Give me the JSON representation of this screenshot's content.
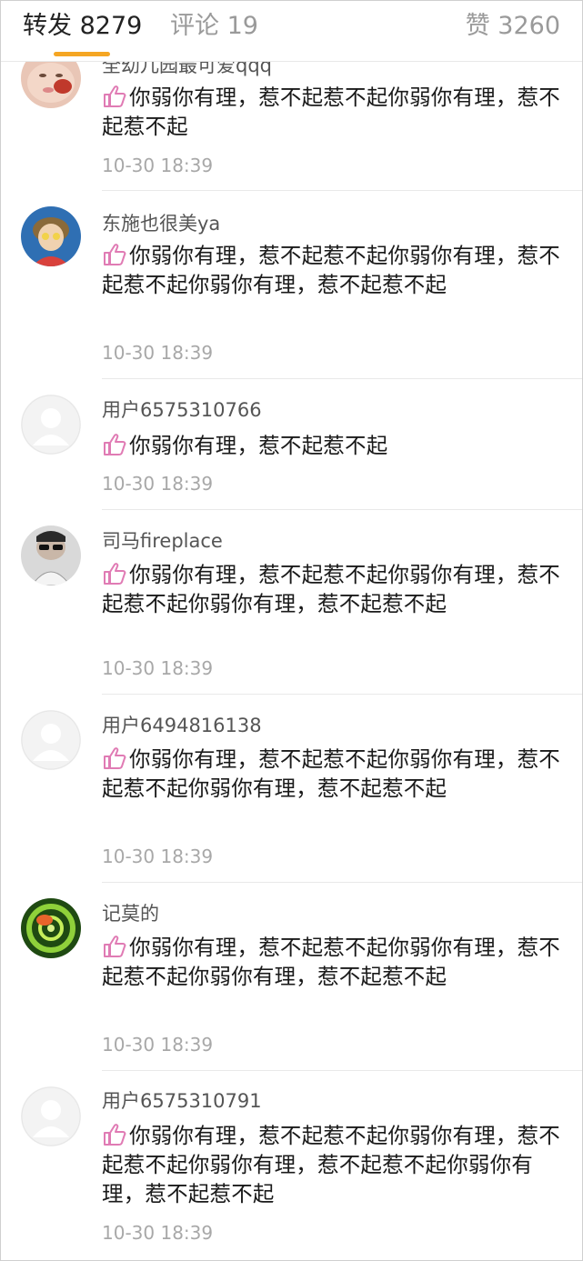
{
  "tabs": {
    "repost_label": "转发",
    "repost_count": "8279",
    "comments_label": "评论 19",
    "likes_label": "赞 3260",
    "accent_color": "#f5a623"
  },
  "items": [
    {
      "name": "全幼儿园最可爱qqq",
      "avatar_icon": "baby-photo-avatar",
      "text": "你弱你有理，惹不起惹不起你弱你有理，惹不起惹不起",
      "time": "10-30 18:39"
    },
    {
      "name": "东施也很美ya",
      "avatar_icon": "cartoon-girl-avatar",
      "text": "你弱你有理，惹不起惹不起你弱你有理，惹不起惹不起你弱你有理，惹不起惹不起",
      "time": "10-30 18:39"
    },
    {
      "name": "用户6575310766",
      "avatar_icon": "default-user-avatar",
      "text": "你弱你有理，惹不起惹不起",
      "time": "10-30 18:39"
    },
    {
      "name": "司马fireplace",
      "avatar_icon": "sunglasses-man-avatar",
      "text": "你弱你有理，惹不起惹不起你弱你有理，惹不起惹不起你弱你有理，惹不起惹不起",
      "time": "10-30 18:39"
    },
    {
      "name": "用户6494816138",
      "avatar_icon": "default-user-avatar",
      "text": "你弱你有理，惹不起惹不起你弱你有理，惹不起惹不起你弱你有理，惹不起惹不起",
      "time": "10-30 18:39"
    },
    {
      "name": "记莫的",
      "avatar_icon": "green-swirl-avatar",
      "text": "你弱你有理，惹不起惹不起你弱你有理，惹不起惹不起你弱你有理，惹不起惹不起",
      "time": "10-30 18:39"
    },
    {
      "name": "用户6575310791",
      "avatar_icon": "default-user-avatar",
      "text": "你弱你有理，惹不起惹不起你弱你有理，惹不起惹不起你弱你有理，惹不起惹不起你弱你有理，惹不起惹不起",
      "time": "10-30 18:39"
    }
  ],
  "emoji_icon": "thumbs-up-icon",
  "emoji_color": "#e2a0c8"
}
